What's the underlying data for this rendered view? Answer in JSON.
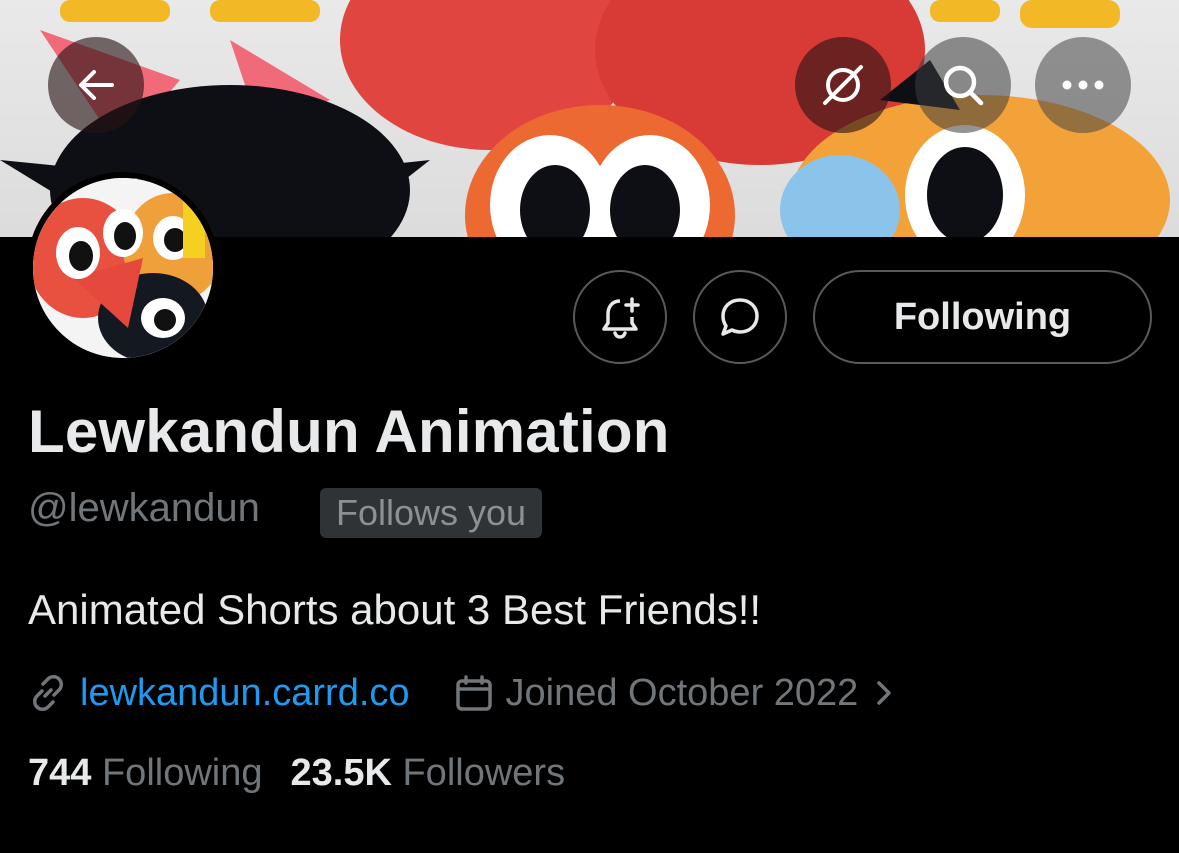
{
  "header": {
    "back_icon": "arrow-left-icon",
    "grok_icon": "grok-icon",
    "search_icon": "search-icon",
    "more_icon": "more-horizontal-icon"
  },
  "actions": {
    "notify_icon": "bell-plus-icon",
    "message_icon": "message-bubble-icon",
    "following_label": "Following"
  },
  "profile": {
    "display_name": "Lewkandun Animation",
    "handle": "@lewkandun",
    "follows_you": "Follows you",
    "bio": "Animated Shorts about 3 Best Friends!!",
    "link": "lewkandun.carrd.co",
    "joined": "Joined October 2022"
  },
  "stats": {
    "following_count": "744",
    "following_label": "Following",
    "followers_count": "23.5K",
    "followers_label": "Followers"
  },
  "colors": {
    "background": "#000000",
    "link": "#1d9bf0",
    "muted": "#71767b",
    "text": "#e7e9ea"
  }
}
